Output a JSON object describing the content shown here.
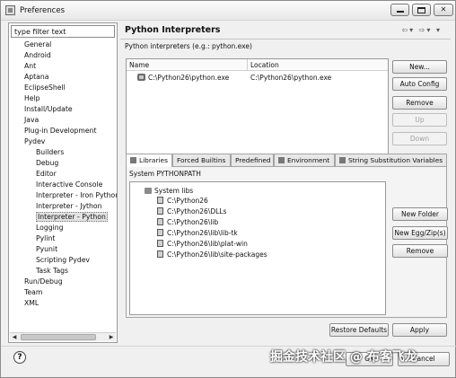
{
  "window": {
    "title": "Preferences"
  },
  "filter": {
    "value": "type filter text"
  },
  "tree": [
    {
      "label": "General",
      "child": false
    },
    {
      "label": "Android",
      "child": false
    },
    {
      "label": "Ant",
      "child": false
    },
    {
      "label": "Aptana",
      "child": false
    },
    {
      "label": "EclipseShell",
      "child": false
    },
    {
      "label": "Help",
      "child": false
    },
    {
      "label": "Install/Update",
      "child": false
    },
    {
      "label": "Java",
      "child": false
    },
    {
      "label": "Plug-in Development",
      "child": false
    },
    {
      "label": "Pydev",
      "child": false
    },
    {
      "label": "Builders",
      "child": true
    },
    {
      "label": "Debug",
      "child": true
    },
    {
      "label": "Editor",
      "child": true
    },
    {
      "label": "Interactive Console",
      "child": true
    },
    {
      "label": "Interpreter - Iron Python",
      "child": true
    },
    {
      "label": "Interpreter - Jython",
      "child": true
    },
    {
      "label": "Interpreter - Python",
      "child": true,
      "selected": true
    },
    {
      "label": "Logging",
      "child": true
    },
    {
      "label": "Pylint",
      "child": true
    },
    {
      "label": "Pyunit",
      "child": true
    },
    {
      "label": "Scripting Pydev",
      "child": true
    },
    {
      "label": "Task Tags",
      "child": true
    },
    {
      "label": "Run/Debug",
      "child": false
    },
    {
      "label": "Team",
      "child": false
    },
    {
      "label": "XML",
      "child": false
    }
  ],
  "page": {
    "title": "Python Interpreters",
    "description": "Python interpreters (e.g.: python.exe)"
  },
  "interpreters": {
    "headers": {
      "name": "Name",
      "location": "Location"
    },
    "rows": [
      {
        "name": "C:\\Python26\\python.exe",
        "location": "C:\\Python26\\python.exe"
      }
    ]
  },
  "interp_buttons": {
    "new": "New...",
    "auto_config": "Auto Config",
    "remove": "Remove",
    "up": "Up",
    "down": "Down"
  },
  "tabs": {
    "libraries": "Libraries",
    "forced_builtins": "Forced Builtins",
    "predefined": "Predefined",
    "environment": "Environment",
    "string_substitution": "String Substitution Variables"
  },
  "libraries": {
    "label": "System PYTHONPATH",
    "root": "System libs",
    "items": [
      "C:\\Python26",
      "C:\\Python26\\DLLs",
      "C:\\Python26\\lib",
      "C:\\Python26\\lib\\lib-tk",
      "C:\\Python26\\lib\\plat-win",
      "C:\\Python26\\lib\\site-packages"
    ]
  },
  "lib_buttons": {
    "new_folder": "New Folder",
    "new_egg": "New Egg/Zip(s)",
    "remove": "Remove"
  },
  "bottom": {
    "restore_defaults": "Restore Defaults",
    "apply": "Apply",
    "help": "?",
    "ok": "OK",
    "cancel": "Cancel"
  },
  "watermark": "掘金技术社区 @ 布客飞龙"
}
